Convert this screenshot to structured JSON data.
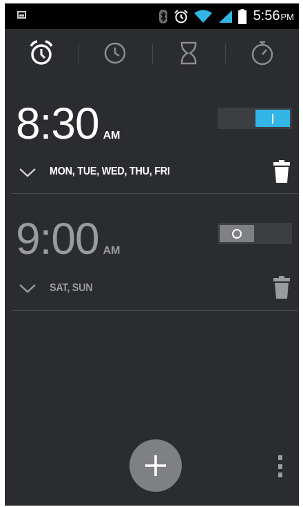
{
  "status_bar": {
    "time": "5:56",
    "ampm": "PM",
    "icons": [
      "screenshot-icon",
      "bluetooth-icon",
      "alarm-icon",
      "wifi-icon",
      "signal-icon",
      "battery-icon"
    ]
  },
  "tabs": [
    {
      "name": "alarm",
      "icon": "alarm-clock-icon",
      "selected": true
    },
    {
      "name": "clock",
      "icon": "clock-icon",
      "selected": false
    },
    {
      "name": "timer",
      "icon": "hourglass-icon",
      "selected": false
    },
    {
      "name": "stopwatch",
      "icon": "stopwatch-icon",
      "selected": false
    }
  ],
  "alarms": [
    {
      "time": "8:30",
      "ampm": "AM",
      "days": "MON, TUE, WED, THU, FRI",
      "enabled": true
    },
    {
      "time": "9:00",
      "ampm": "AM",
      "days": "SAT, SUN",
      "enabled": false
    }
  ],
  "colors": {
    "background": "#2b2c2f",
    "accent": "#33b5e5",
    "active_text": "#ffffff",
    "inactive_text": "#9a9b9e"
  }
}
